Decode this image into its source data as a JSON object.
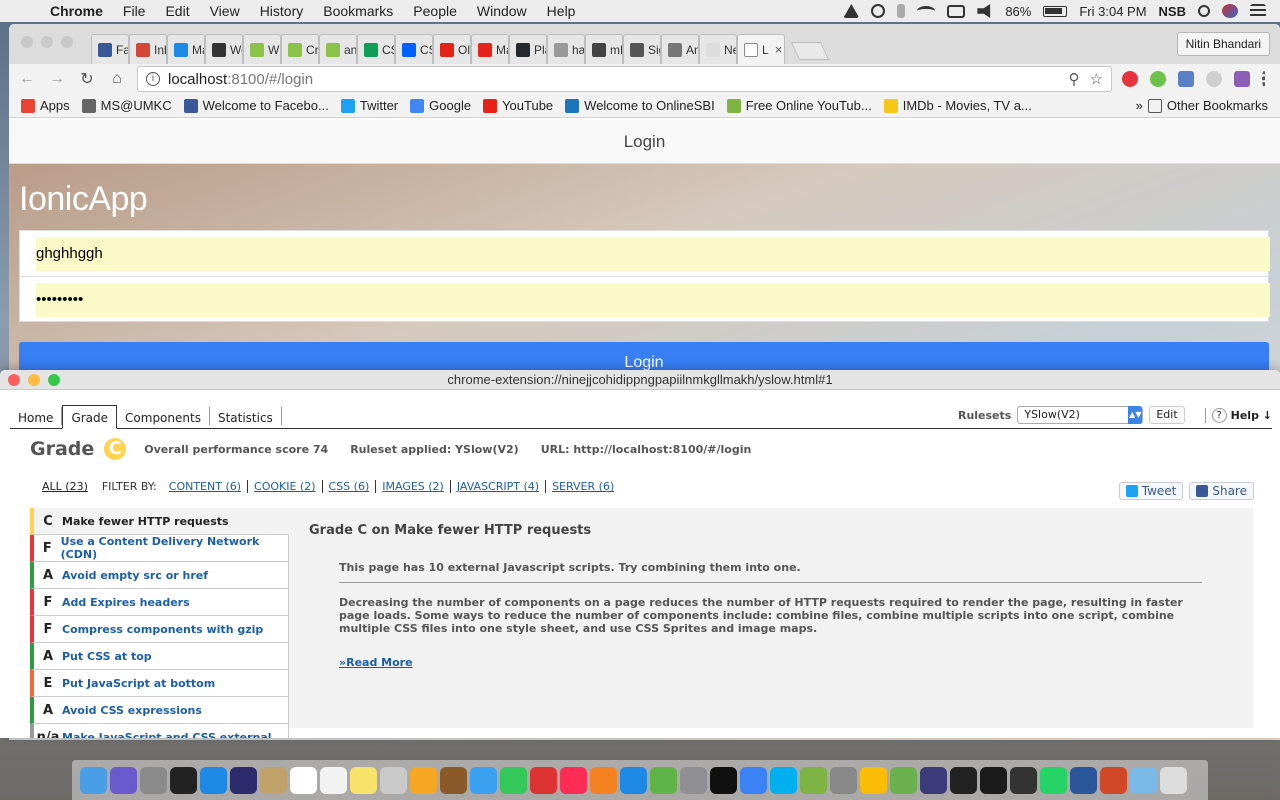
{
  "menubar": {
    "app": "Chrome",
    "items": [
      "File",
      "Edit",
      "View",
      "History",
      "Bookmarks",
      "People",
      "Window",
      "Help"
    ],
    "battery": "86%",
    "clock": "Fri 3:04 PM",
    "user": "NSB"
  },
  "browser": {
    "tabs": [
      {
        "label": "Fac",
        "color": "#3b5998"
      },
      {
        "label": "Inb",
        "color": "#d44638"
      },
      {
        "label": "Mai",
        "color": "#1e88e5"
      },
      {
        "label": "Wel",
        "color": "#333333"
      },
      {
        "label": "Wif",
        "color": "#8bc34a"
      },
      {
        "label": "Cre",
        "color": "#8bc34a"
      },
      {
        "label": "and",
        "color": "#8bc34a"
      },
      {
        "label": "CSE",
        "color": "#0f9d58"
      },
      {
        "label": "CSE",
        "color": "#0061ff"
      },
      {
        "label": "Old",
        "color": "#e62117"
      },
      {
        "label": "Mat",
        "color": "#e62117"
      },
      {
        "label": "Pla",
        "color": "#24292e"
      },
      {
        "label": "had",
        "color": "#999999"
      },
      {
        "label": "mLa",
        "color": "#444444"
      },
      {
        "label": "Sig",
        "color": "#555555"
      },
      {
        "label": "And",
        "color": "#777777"
      },
      {
        "label": "New Ta",
        "color": "#dddddd"
      },
      {
        "label": "L",
        "color": "#ffffff",
        "active": true
      }
    ],
    "profile": "Nitin Bhandari",
    "url_host": "localhost",
    "url_path": ":8100/#/login",
    "bookmarks": [
      {
        "label": "Apps",
        "color": "#ea4335"
      },
      {
        "label": "MS@UMKC",
        "color": "#666666"
      },
      {
        "label": "Welcome to Facebo...",
        "color": "#3b5998"
      },
      {
        "label": "Twitter",
        "color": "#1da1f2"
      },
      {
        "label": "Google",
        "color": "#4285f4"
      },
      {
        "label": "YouTube",
        "color": "#e62117"
      },
      {
        "label": "Welcome to OnlineSBI",
        "color": "#1c75bc"
      },
      {
        "label": "Free Online YouTub...",
        "color": "#7cb342"
      },
      {
        "label": "IMDb - Movies, TV a...",
        "color": "#f5c518"
      }
    ],
    "other_bookmarks": "Other Bookmarks"
  },
  "app": {
    "header_title": "Login",
    "brand": "IonicApp",
    "username_value": "ghghhggh",
    "password_value": "•••••••••",
    "login_button": "Login"
  },
  "yslow": {
    "window_title": "chrome-extension://ninejjcohidippngpapiilnmkgllmakh/yslow.html#1",
    "tabs": [
      "Home",
      "Grade",
      "Components",
      "Statistics"
    ],
    "active_tab": "Grade",
    "rulesets_label": "Rulesets",
    "ruleset_value": "YSlow(V2)",
    "edit_label": "Edit",
    "help_label": "Help ↓",
    "grade_title": "Grade",
    "grade_letter": "C",
    "overall_score": "Overall performance score 74",
    "ruleset_applied": "Ruleset applied: YSlow(V2)",
    "url": "URL: http://localhost:8100/#/login",
    "filter_all": "ALL (23)",
    "filter_by": "FILTER BY:",
    "filters": [
      "CONTENT (6)",
      "COOKIE (2)",
      "CSS (6)",
      "IMAGES (2)",
      "JAVASCRIPT (4)",
      "SERVER (6)"
    ],
    "tweet": "Tweet",
    "share": "Share",
    "rules": [
      {
        "grade": "C",
        "title": "Make fewer HTTP requests",
        "color": "#ffd34f",
        "selected": true
      },
      {
        "grade": "F",
        "title": "Use a Content Delivery Network (CDN)",
        "color": "#e8343e"
      },
      {
        "grade": "A",
        "title": "Avoid empty src or href",
        "color": "#2d9c43"
      },
      {
        "grade": "F",
        "title": "Add Expires headers",
        "color": "#e8343e"
      },
      {
        "grade": "F",
        "title": "Compress components with gzip",
        "color": "#e8343e"
      },
      {
        "grade": "A",
        "title": "Put CSS at top",
        "color": "#2d9c43"
      },
      {
        "grade": "E",
        "title": "Put JavaScript at bottom",
        "color": "#f2693a"
      },
      {
        "grade": "A",
        "title": "Avoid CSS expressions",
        "color": "#2d9c43"
      },
      {
        "grade": "n/a",
        "title": "Make JavaScript and CSS external",
        "color": "#999999"
      }
    ],
    "detail_heading": "Grade C on Make fewer HTTP requests",
    "detail_message": "This page has 10 external Javascript scripts. Try combining them into one.",
    "detail_description": "Decreasing the number of components on a page reduces the number of HTTP requests required to render the page, resulting in faster page loads. Some ways to reduce the number of components include: combine files, combine multiple scripts into one script, combine multiple CSS files into one style sheet, and use CSS Sprites and image maps.",
    "read_more": "»Read More"
  },
  "dock": {
    "apps": [
      "Finder",
      "Siri",
      "Launchpad",
      "Activity Monitor",
      "Safari",
      "Eclipse",
      "Preview",
      "Calendar",
      "Notes",
      "Stickies",
      "Photo Booth",
      "Photos",
      "Notefile",
      "Messages",
      "FaceTime",
      "Photo Editor",
      "iTunes",
      "iBooks",
      "App Store",
      "uTorrent",
      "System Preferences",
      "IntelliJ",
      "Xcode",
      "Skype",
      "Android Studio",
      "Screenshot",
      "Chrome",
      "Maps",
      "Eclipse EE",
      "WebStorm",
      "Terminal",
      "GitHub",
      "WhatsApp",
      "Word",
      "PowerPoint",
      "Downloads",
      "Trash"
    ],
    "colors": [
      "#4a9ee6",
      "#6a5acd",
      "#8a8a8a",
      "#222222",
      "#1e88e5",
      "#2c2c6c",
      "#c0a16a",
      "#ffffff",
      "#f2f2f2",
      "#f7e26b",
      "#c9c9c9",
      "#f5a623",
      "#8b5a2b",
      "#3aa0f2",
      "#34c759",
      "#d33",
      "#ff2d55",
      "#f58220",
      "#1e88e5",
      "#5fb347",
      "#8e8e93",
      "#111111",
      "#3b82f6",
      "#00aff0",
      "#7cb342",
      "#888888",
      "#fbbc05",
      "#6ab04c",
      "#3b3b7a",
      "#222222",
      "#1b1b1b",
      "#333333",
      "#25d366",
      "#2b579a",
      "#d24726",
      "#7ab8e8",
      "#dcdcdc"
    ]
  }
}
